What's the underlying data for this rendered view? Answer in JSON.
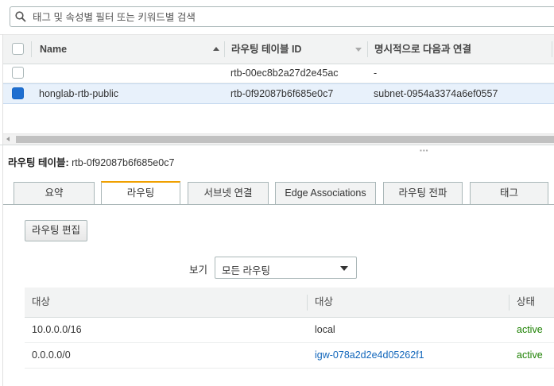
{
  "search": {
    "placeholder": "태그 및 속성별 필터 또는 키워드별 검색"
  },
  "route_tables": {
    "columns": [
      "Name",
      "라우팅 테이블 ID",
      "명시적으로 다음과 연결"
    ],
    "rows": [
      {
        "name": "",
        "id": "rtb-00ec8b2a27d2e45ac",
        "association": "-",
        "selected": false
      },
      {
        "name": "honglab-rtb-public",
        "id": "rtb-0f92087b6f685e0c7",
        "association": "subnet-0954a3374a6ef0557",
        "selected": true
      }
    ]
  },
  "detail": {
    "label": "라우팅 테이블:",
    "value": "rtb-0f92087b6f685e0c7",
    "tabs": [
      "요약",
      "라우팅",
      "서브넷 연결",
      "Edge Associations",
      "라우팅 전파",
      "태그"
    ],
    "active_tab": "라우팅",
    "edit_button": "라우팅 편집",
    "filter_label": "보기",
    "filter_value": "모든 라우팅",
    "routes_columns": [
      "대상",
      "대상",
      "상태"
    ],
    "routes": [
      {
        "destination": "10.0.0.0/16",
        "target": "local",
        "status": "active"
      },
      {
        "destination": "0.0.0.0/0",
        "target": "igw-078a2d2e4d05262f1",
        "status": "active"
      }
    ]
  },
  "colors": {
    "accent_tab": "#f0a000",
    "link": "#1166bb",
    "status_active": "#1d8102",
    "selected_checkbox": "#1f6fd0"
  }
}
